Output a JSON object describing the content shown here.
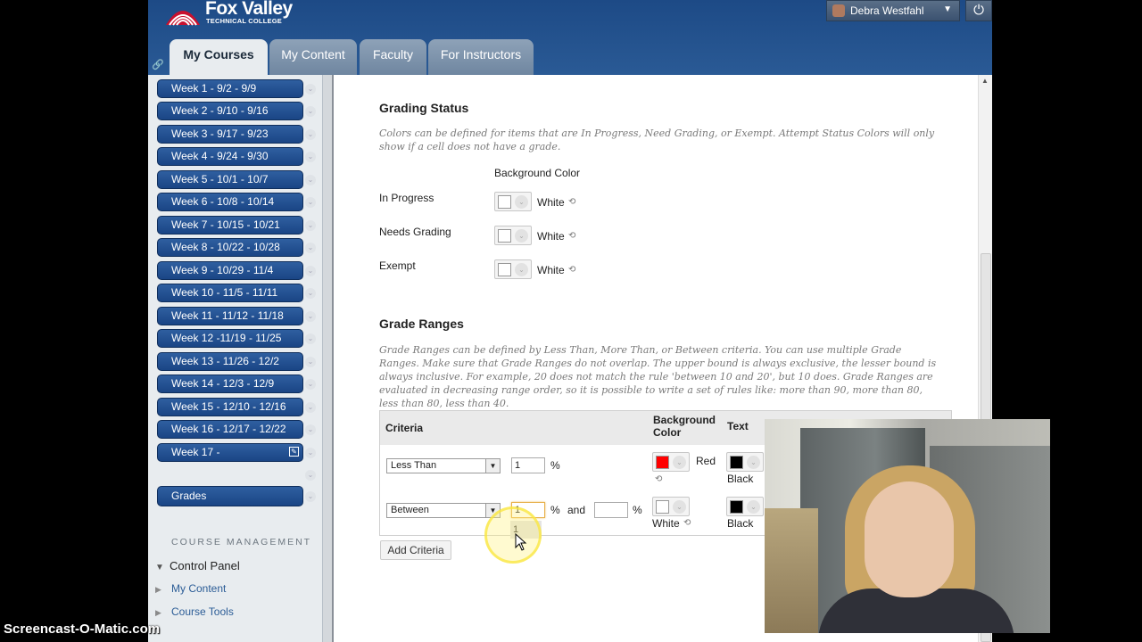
{
  "header": {
    "logo_line1": "Fox Valley",
    "logo_line2": "TECHNICAL COLLEGE",
    "user_name": "Debra Westfahl",
    "tabs": [
      {
        "label": "My Courses"
      },
      {
        "label": "My Content"
      },
      {
        "label": "Faculty"
      },
      {
        "label": "For Instructors"
      }
    ]
  },
  "sidebar": {
    "weeks": [
      "Week 1 - 9/2 - 9/9",
      "Week 2 - 9/10 - 9/16",
      "Week 3 - 9/17 - 9/23",
      "Week 4 - 9/24 - 9/30",
      "Week 5 - 10/1 - 10/7",
      "Week 6 - 10/8 - 10/14",
      "Week 7 - 10/15 - 10/21",
      "Week 8 - 10/22 - 10/28",
      "Week 9 - 10/29 - 11/4",
      "Week 10 - 11/5 - 11/11",
      "Week 11 - 11/12 - 11/18",
      "Week 12 -11/19 - 11/25",
      "Week 13 - 11/26 - 12/2",
      "Week 14 - 12/3 - 12/9",
      "Week 15 - 12/10 - 12/16",
      "Week 16 - 12/17 - 12/22",
      "Week 17 -"
    ],
    "grades": "Grades",
    "course_management": "COURSE MANAGEMENT",
    "control_panel": "Control Panel",
    "cp_items": [
      "My Content",
      "Course Tools"
    ]
  },
  "grading_status": {
    "title": "Grading Status",
    "help": "Colors can be defined for items that are In Progress, Need Grading, or Exempt. Attempt Status Colors will only show if a cell does not have a grade.",
    "bg_header": "Background Color",
    "rows": [
      {
        "label": "In Progress",
        "color_name": "White",
        "color": "#ffffff"
      },
      {
        "label": "Needs Grading",
        "color_name": "White",
        "color": "#ffffff"
      },
      {
        "label": "Exempt",
        "color_name": "White",
        "color": "#ffffff"
      }
    ]
  },
  "grade_ranges": {
    "title": "Grade Ranges",
    "help": "Grade Ranges can be defined by Less Than, More Than, or Between criteria. You can use multiple Grade Ranges. Make sure that Grade Ranges do not overlap. The upper bound is always exclusive, the lesser bound is always inclusive. For example, 20 does not match the rule 'between 10 and 20', but 10 does. Grade Ranges are evaluated in decreasing range order, so it is possible to write a set of rules like: more than 90, more than 80, less than 80, less than 40.",
    "headers": {
      "criteria": "Criteria",
      "bg_line1": "Background",
      "bg_line2": "Color",
      "text": "Text"
    },
    "row1": {
      "criteria": "Less Than",
      "value": "1",
      "pct": "%",
      "bg_name": "Red",
      "bg_color": "#ff0000",
      "text_name": "Black",
      "text_color": "#000000"
    },
    "row2": {
      "criteria": "Between",
      "value": "1",
      "pct": "%",
      "and": "and",
      "value2": "",
      "pct2": "%",
      "bg_name": "White",
      "bg_color": "#ffffff",
      "text_name": "Black",
      "text_color": "#000000"
    },
    "autocomplete": "1",
    "add_criteria": "Add Criteria"
  },
  "watermark": "Screencast-O-Matic.com"
}
